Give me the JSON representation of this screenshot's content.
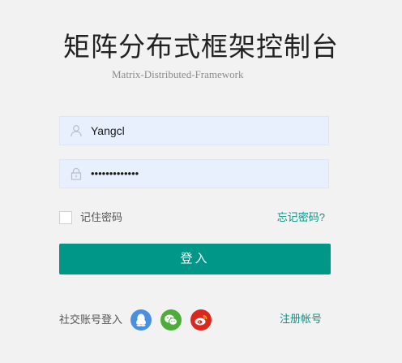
{
  "header": {
    "title": "矩阵分布式框架控制台",
    "subtitle": "Matrix-Distributed-Framework"
  },
  "form": {
    "username": {
      "value": "Yangcl",
      "icon": "user-icon"
    },
    "password": {
      "value": "•••••••••••••",
      "icon": "lock-icon"
    },
    "remember_label": "记住密码",
    "remember_checked": false,
    "forgot_label": "忘记密码?",
    "login_label": "登入"
  },
  "social": {
    "label": "社交账号登入",
    "icons": [
      "qq-icon",
      "wechat-icon",
      "weibo-icon"
    ],
    "register_label": "注册帐号"
  },
  "colors": {
    "accent": "#009688",
    "background": "#f2f2f2",
    "input_background": "#e8f0fe",
    "qq": "#4a90e2",
    "wechat": "#4cae38",
    "weibo": "#d9281e"
  }
}
